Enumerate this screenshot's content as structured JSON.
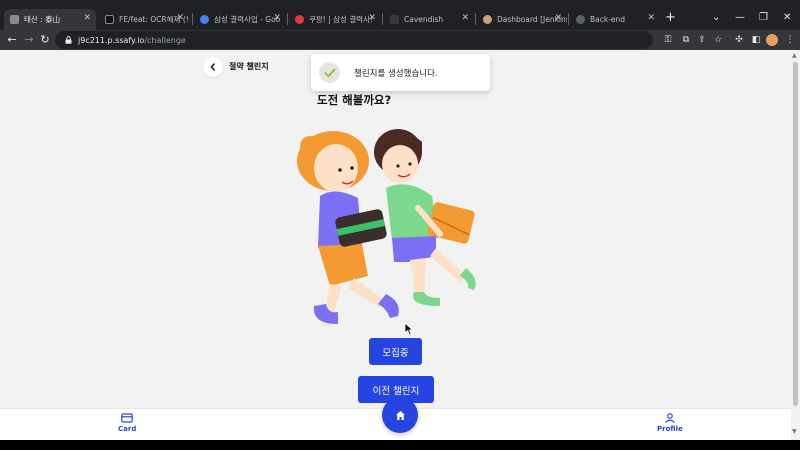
{
  "browser": {
    "tabs": [
      {
        "title": "태산 : 泰山",
        "active": true,
        "favicon_color": "#8a8a8a"
      },
      {
        "title": "FE/feat: OCR해제 (!",
        "active": false,
        "favicon_color": "#111111"
      },
      {
        "title": "삼성 결력사업 - Goo",
        "active": false,
        "favicon_color": "#4285f4"
      },
      {
        "title": "쿠팡! | 삼성 결력사!",
        "active": false,
        "favicon_color": "#e53935"
      },
      {
        "title": "Cavendish",
        "active": false,
        "favicon_color": "#3a3a3a"
      },
      {
        "title": "Dashboard [Jenkins]",
        "active": false,
        "favicon_color": "#c8a27a"
      },
      {
        "title": "Back-end",
        "active": false,
        "favicon_color": "#5f6368"
      }
    ],
    "new_tab_label": "+",
    "url_host": "j9c211.p.ssafy.io",
    "url_path": "/challenge"
  },
  "header": {
    "title": "절약 챌린지"
  },
  "toast": {
    "message": "챌린지를 생성했습니다."
  },
  "main": {
    "question": "도전 해볼까요?",
    "recruit_button": "모집중",
    "previous_button": "이전 챌린지"
  },
  "bottom_nav": {
    "card_label": "Card",
    "profile_label": "Profile"
  },
  "colors": {
    "accent": "#2645e0",
    "page_bg": "#f2f2f2"
  }
}
